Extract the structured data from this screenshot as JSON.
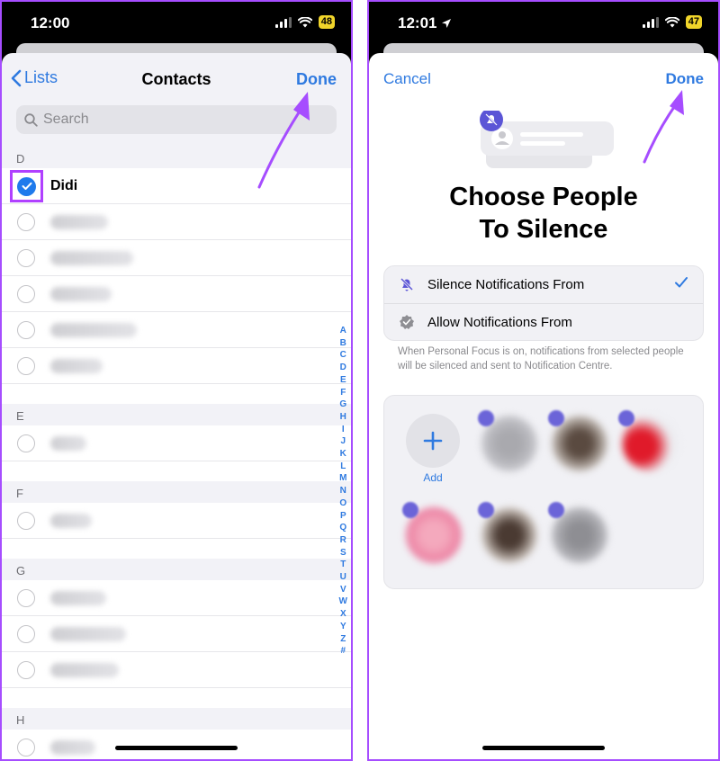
{
  "left": {
    "status": {
      "time": "12:00",
      "battery": "48"
    },
    "nav": {
      "back": "Lists",
      "title": "Contacts",
      "done": "Done"
    },
    "search": {
      "placeholder": "Search"
    },
    "sections": [
      {
        "letter": "D",
        "contacts": [
          "Didi"
        ]
      },
      {
        "letter": "E"
      },
      {
        "letter": "F"
      },
      {
        "letter": "G"
      },
      {
        "letter": "H"
      }
    ],
    "index": [
      "A",
      "B",
      "C",
      "D",
      "E",
      "F",
      "G",
      "H",
      "I",
      "J",
      "K",
      "L",
      "M",
      "N",
      "O",
      "P",
      "Q",
      "R",
      "S",
      "T",
      "U",
      "V",
      "W",
      "X",
      "Y",
      "Z",
      "#"
    ]
  },
  "right": {
    "status": {
      "time": "12:01",
      "battery": "47"
    },
    "nav": {
      "cancel": "Cancel",
      "done": "Done"
    },
    "heading_line1": "Choose People",
    "heading_line2": "To Silence",
    "options": [
      {
        "label": "Silence Notifications From",
        "selected": true
      },
      {
        "label": "Allow Notifications From",
        "selected": false
      }
    ],
    "footnote": "When Personal Focus is on, notifications from selected people will be silenced and sent to Notification Centre.",
    "add_label": "Add"
  },
  "colors": {
    "accent": "#2f7ae0",
    "highlight": "#b040ff",
    "battery": "#f1d52a"
  }
}
